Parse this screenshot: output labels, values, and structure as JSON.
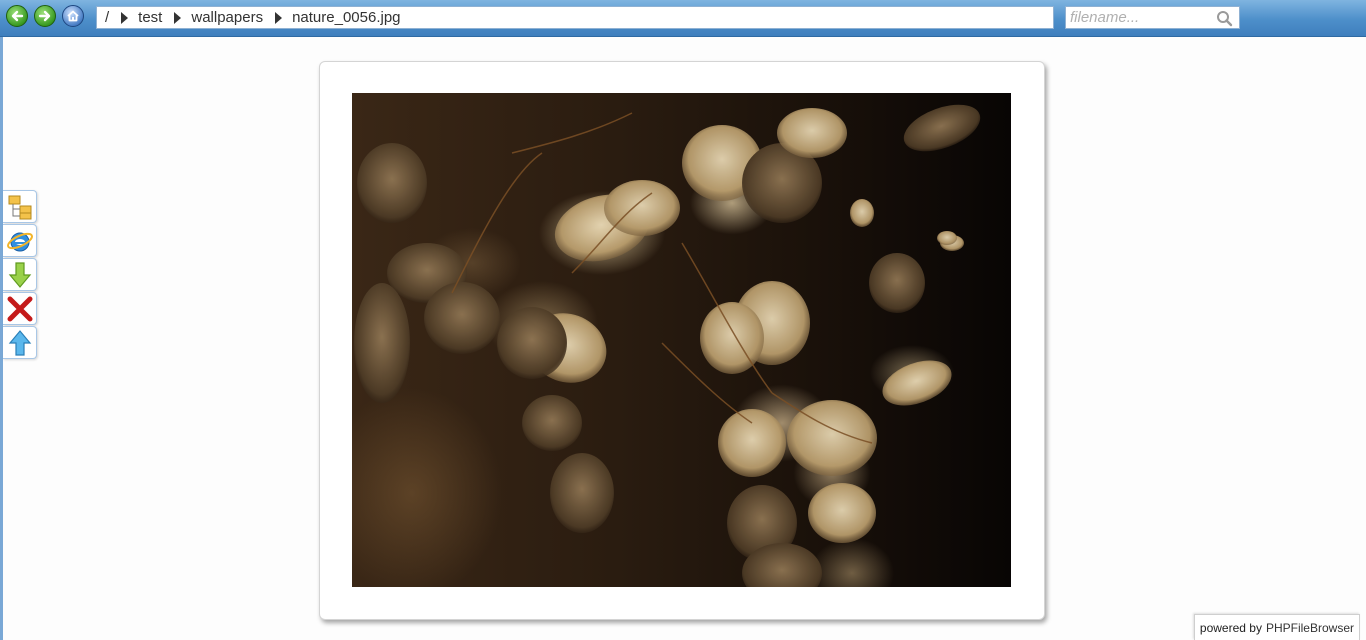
{
  "navigation": {
    "back_icon": "back-arrow-icon",
    "forward_icon": "forward-arrow-icon",
    "home_icon": "home-icon"
  },
  "breadcrumb": {
    "root": "/",
    "items": [
      "test",
      "wallpapers",
      "nature_0056.jpg"
    ]
  },
  "search": {
    "placeholder": "filename...",
    "value": "",
    "icon": "search-icon"
  },
  "toolbar": {
    "items": [
      {
        "icon": "folder-tree-icon",
        "action": "tree"
      },
      {
        "icon": "browser-open-icon",
        "action": "open"
      },
      {
        "icon": "download-arrow-icon",
        "action": "download"
      },
      {
        "icon": "delete-x-icon",
        "action": "delete"
      },
      {
        "icon": "upload-arrow-icon",
        "action": "upload"
      }
    ]
  },
  "preview": {
    "filename": "nature_0056.jpg"
  },
  "footer": {
    "powered_prefix": "powered by",
    "powered_link": "PHPFileBrowser"
  },
  "colors": {
    "topbar": "#4d8fca",
    "nav_green": "#3a9b22",
    "delete_red": "#c41a1a",
    "download_green": "#8cc63f",
    "upload_blue": "#3aa0e0"
  }
}
